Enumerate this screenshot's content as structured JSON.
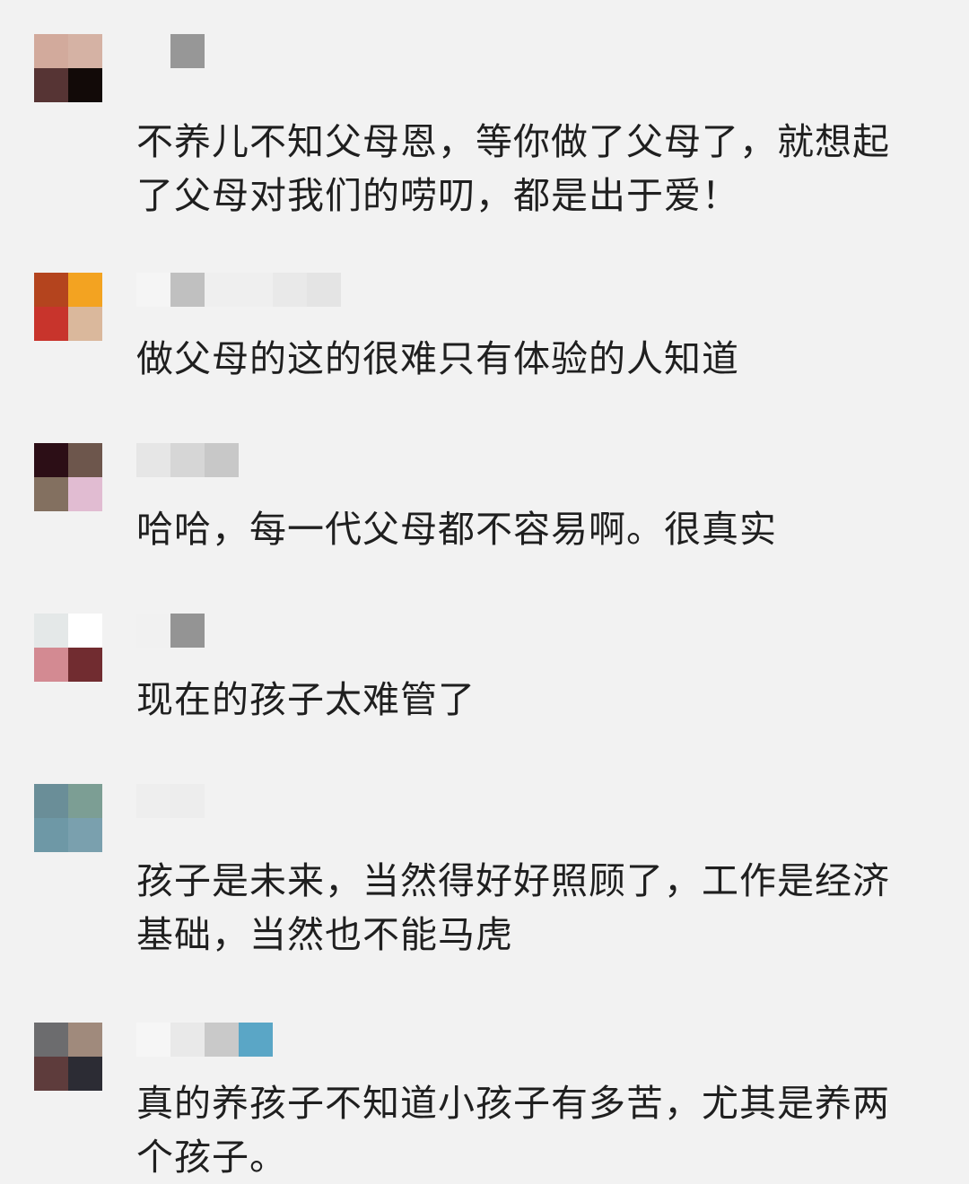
{
  "comments": [
    {
      "text": "不养儿不知父母恩，等你做了父母了，就想起了父母对我们的唠叨，都是出于爱！",
      "avatar_colors": [
        "#d2aa9c",
        "#d5b2a4",
        "#563434",
        "#120a08"
      ],
      "name_colors": [
        "#f2f2f2",
        "#979797"
      ]
    },
    {
      "text": "做父母的这的很难只有体验的人知道",
      "avatar_colors": [
        "#b4441e",
        "#f3a321",
        "#c8342c",
        "#dab89c"
      ],
      "name_colors": [
        "#f5f5f5",
        "#c0c0c0",
        "#efefef",
        "#e9e9e9",
        "#e4e4e4"
      ]
    },
    {
      "text": "哈哈，每一代父母都不容易啊。很真实",
      "avatar_colors": [
        "#2c0e16",
        "#6d564c",
        "#837060",
        "#e1bcd2"
      ],
      "name_colors": [
        "#e6e6e6",
        "#d6d6d6",
        "#c8c8c8"
      ]
    },
    {
      "text": "现在的孩子太难管了",
      "avatar_colors": [
        "#e4e8e8",
        "#ffffff",
        "#d38a92",
        "#712c30"
      ],
      "name_colors": [
        "#f1f1f1",
        "#949494"
      ]
    },
    {
      "text": "孩子是未来，当然得好好照顾了，工作是经济基础，当然也不能马虎",
      "avatar_colors": [
        "#6a8e98",
        "#7c9e94",
        "#6e98a6",
        "#7aa0ae"
      ],
      "name_colors": [
        "#eeeeee",
        "#ededed"
      ]
    },
    {
      "text": "真的养孩子不知道小孩子有多苦，尤其是养两个孩子。",
      "avatar_colors": [
        "#6c6c6e",
        "#a08a7c",
        "#5e3c3c",
        "#2c2c34"
      ],
      "name_colors": [
        "#f6f6f6",
        "#e9e9e9",
        "#c9c9c9",
        "#5aa6c6"
      ]
    }
  ]
}
